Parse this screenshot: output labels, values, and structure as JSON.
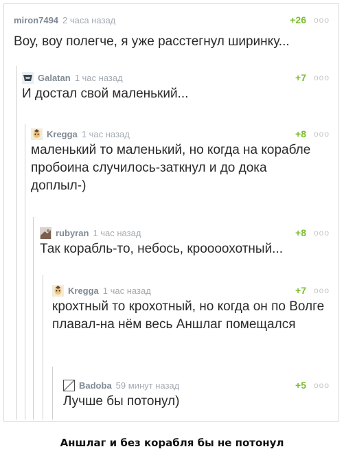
{
  "comments": [
    {
      "author": "miron7494",
      "time": "2 часа назад",
      "score": "+26",
      "dots": "ooo",
      "text": "Воу, воу полегче, я уже расстегнул ширинку..."
    },
    {
      "author": "Galatan",
      "time": "1 час назад",
      "score": "+7",
      "dots": "ooo",
      "text": "И достал свой маленький..."
    },
    {
      "author": "Kregga",
      "time": "1 час назад",
      "score": "+8",
      "dots": "ooo",
      "text": "маленький то маленький, но когда на корабле пробоина случилось-заткнул и до дока доплыл-)"
    },
    {
      "author": "rubyran",
      "time": "1 час назад",
      "score": "+8",
      "dots": "ooo",
      "text": "Так корабль-то, небось, кроооохотный..."
    },
    {
      "author": "Kregga",
      "time": "1 час назад",
      "score": "+7",
      "dots": "ooo",
      "text": "крохтный то крохотный, но когда он по Волге плавал-на нём весь Аншлаг помещался"
    },
    {
      "author": "Badoba",
      "time": "59 минут назад",
      "score": "+5",
      "dots": "ooo",
      "text": "Лучше бы потонул)"
    }
  ],
  "caption": "Аншлаг и без корабля бы не потонул",
  "colors": {
    "score": "#7cbd32",
    "author": "#7f8a94",
    "time": "#a3aab1",
    "text": "#2a2a2a",
    "thread_line": "#cfcfcf"
  }
}
